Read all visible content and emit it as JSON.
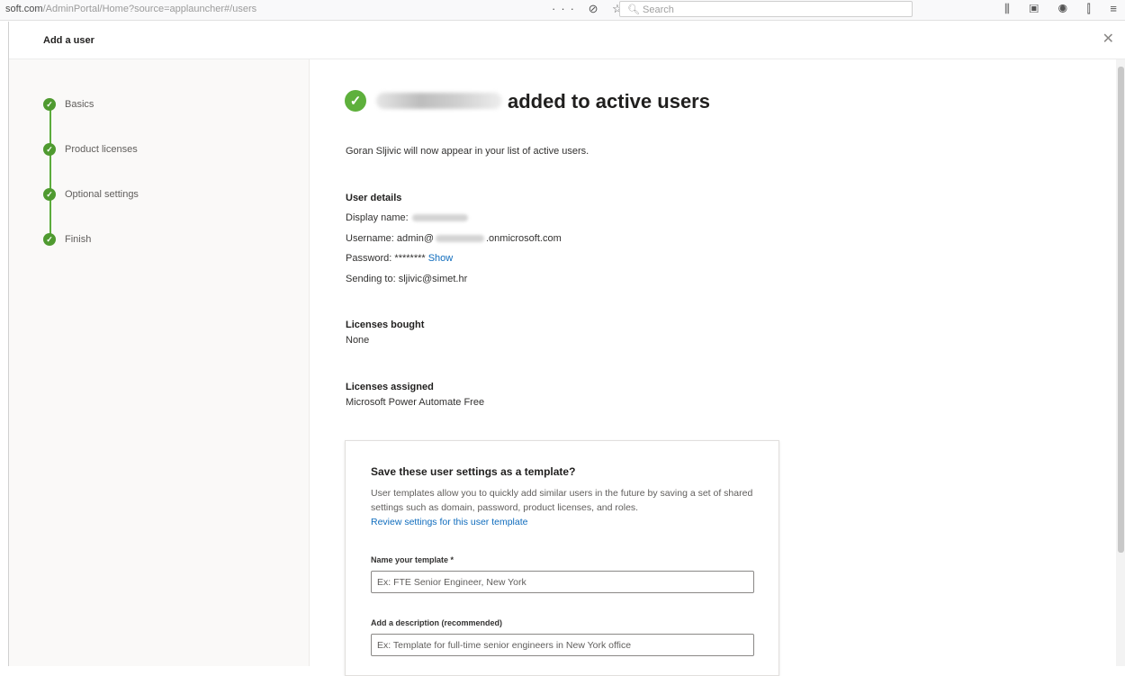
{
  "browser": {
    "url_domain": "soft.com",
    "url_path": "/AdminPortal/Home?source=applauncher#/users",
    "toolbar_icons": "··· ⊘ ☆",
    "search_placeholder": "Search",
    "right_icons": "⫼ ▣ ◉ ⫿ ≡"
  },
  "panel": {
    "title": "Add a user",
    "close_glyph": "✕"
  },
  "steps": [
    {
      "label": "Basics",
      "done": true
    },
    {
      "label": "Product licenses",
      "done": true
    },
    {
      "label": "Optional settings",
      "done": true
    },
    {
      "label": "Finish",
      "done": true
    }
  ],
  "main": {
    "check_glyph": "✓",
    "headline": "added to active users",
    "subtext": "Goran Sljivic will now appear in your list of active users.",
    "user_details": {
      "title": "User details",
      "display_name_label": "Display name:",
      "username_prefix": "Username: admin@",
      "username_suffix": ".onmicrosoft.com",
      "password_label": "Password: ********",
      "password_show": "Show",
      "sending_to": "Sending to: sljivic@simet.hr"
    },
    "licenses_bought": {
      "title": "Licenses bought",
      "value": "None"
    },
    "licenses_assigned": {
      "title": "Licenses assigned",
      "value": "Microsoft Power Automate Free"
    }
  },
  "template_card": {
    "title": "Save these user settings as a template?",
    "description": "User templates allow you to quickly add similar users in the future by saving a set of shared settings such as domain, password, product licenses, and roles.",
    "review_link": "Review settings for this user template",
    "name_label": "Name your template *",
    "name_placeholder": "Ex: FTE Senior Engineer, New York",
    "desc_label": "Add a description (recommended)",
    "desc_placeholder": "Ex: Template for full-time senior engineers in New York office"
  },
  "colors": {
    "success_green": "#5eb03c",
    "link_blue": "#0f6cbd",
    "step_line": "#5cac3c"
  }
}
